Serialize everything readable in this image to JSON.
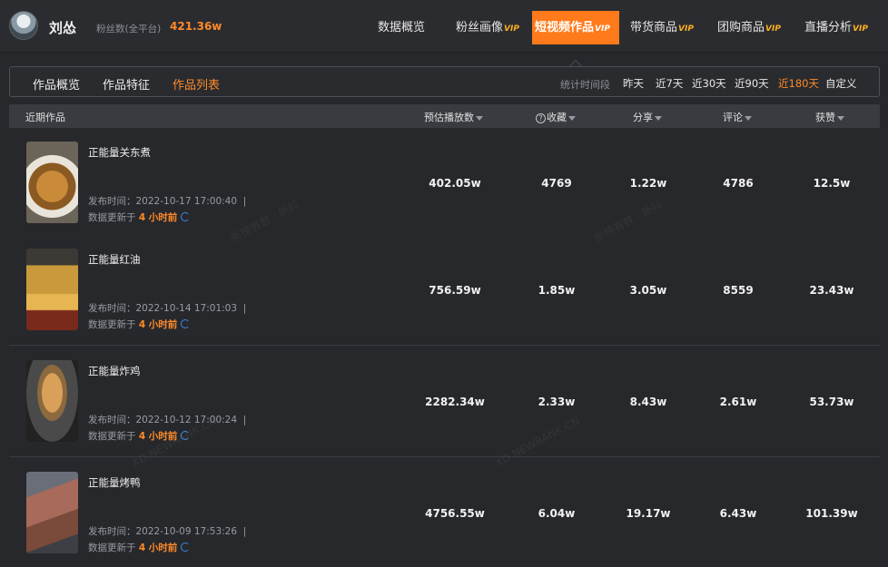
{
  "header": {
    "user_name": "刘怂",
    "fans_label": "粉丝数(全平台)",
    "fans_value": "421.36w",
    "vip_badge": "VIP",
    "nav": [
      {
        "label": "数据概览",
        "vip": false,
        "active": false
      },
      {
        "label": "粉丝画像",
        "vip": true,
        "active": false
      },
      {
        "label": "短视频作品",
        "vip": true,
        "active": true
      },
      {
        "label": "带货商品",
        "vip": true,
        "active": false
      },
      {
        "label": "团购商品",
        "vip": true,
        "active": false
      },
      {
        "label": "直播分析",
        "vip": true,
        "active": false
      }
    ]
  },
  "subtabs": {
    "items": [
      "作品概览",
      "作品特征",
      "作品列表"
    ],
    "active": "作品列表",
    "period_label": "统计时间段",
    "periods": [
      "昨天",
      "近7天",
      "近30天",
      "近90天",
      "近180天",
      "自定义"
    ],
    "active_period": "近180天"
  },
  "table": {
    "columns": [
      "近期作品",
      "预估播放数",
      "收藏",
      "分享",
      "评论",
      "获赞"
    ],
    "question_mark": "?",
    "pub_prefix": "发布时间：",
    "updated_prefix": "数据更新于",
    "updated_ago": "4 小时前",
    "rows": [
      {
        "title": "正能量关东煮",
        "pub_time": "2022-10-17 17:00:40",
        "plays": "402.05w",
        "favorites": "4769",
        "shares": "1.22w",
        "comments": "4786",
        "likes": "12.5w"
      },
      {
        "title": "正能量红油",
        "pub_time": "2022-10-14 17:01:03",
        "plays": "756.59w",
        "favorites": "1.85w",
        "shares": "3.05w",
        "comments": "8559",
        "likes": "23.43w"
      },
      {
        "title": "正能量炸鸡",
        "pub_time": "2022-10-12 17:00:24",
        "plays": "2282.34w",
        "favorites": "2.33w",
        "shares": "8.43w",
        "comments": "2.61w",
        "likes": "53.73w"
      },
      {
        "title": "正能量烤鸭",
        "pub_time": "2022-10-09 17:53:26",
        "plays": "4756.55w",
        "favorites": "6.04w",
        "shares": "19.17w",
        "comments": "6.43w",
        "likes": "101.39w"
      }
    ]
  },
  "watermarks": [
    "新榜有数 · 新抖",
    "XD.NEWRANK.CN"
  ],
  "colors": {
    "accent": "#ff7a1a",
    "background": "#27282c",
    "refresh": "#3a8ee6"
  }
}
